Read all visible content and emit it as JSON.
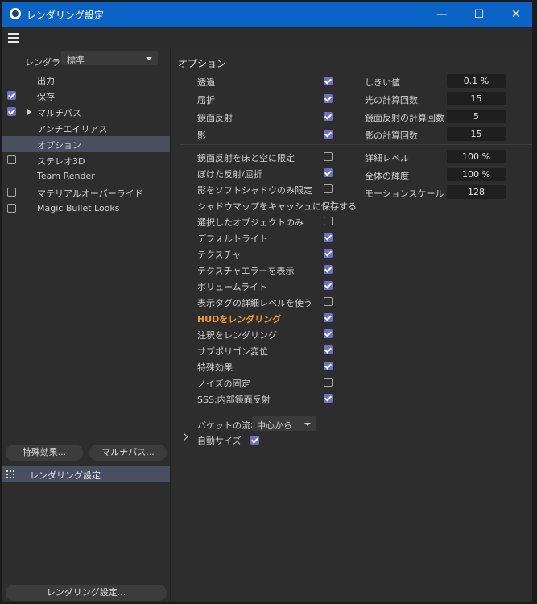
{
  "window": {
    "title": "レンダリング設定",
    "controls": {
      "minimize": "—",
      "maximize": "☐",
      "close": "✕"
    }
  },
  "left": {
    "renderer_label": "レンダラー",
    "renderer_value": "標準",
    "items": [
      {
        "label": "出力",
        "checkbox": null,
        "active": false,
        "expandable": false
      },
      {
        "label": "保存",
        "checkbox": true,
        "active": false,
        "expandable": false
      },
      {
        "label": "マルチパス",
        "checkbox": true,
        "active": false,
        "expandable": true
      },
      {
        "label": "アンチエイリアス",
        "checkbox": null,
        "active": false,
        "expandable": false
      },
      {
        "label": "オプション",
        "checkbox": null,
        "active": true,
        "expandable": false
      },
      {
        "label": "ステレオ3D",
        "checkbox": false,
        "active": false,
        "expandable": false
      },
      {
        "label": "Team Render",
        "checkbox": null,
        "active": false,
        "expandable": false
      },
      {
        "label": "マテリアルオーバーライド",
        "checkbox": false,
        "active": false,
        "expandable": false
      },
      {
        "label": "Magic Bullet Looks",
        "checkbox": false,
        "active": false,
        "expandable": false
      }
    ],
    "effects_button": "特殊効果...",
    "multipass_button": "マルチパス...",
    "preset_item": "レンダリング設定",
    "bottom_button": "レンダリング設定..."
  },
  "options": {
    "title": "オプション",
    "top_checks": [
      {
        "label": "透過",
        "checked": true
      },
      {
        "label": "屈折",
        "checked": true
      },
      {
        "label": "鏡面反射",
        "checked": true
      },
      {
        "label": "影",
        "checked": true
      }
    ],
    "top_fields": [
      {
        "label": "しきい値",
        "value": "0.1 %"
      },
      {
        "label": "光の計算回数",
        "value": "15"
      },
      {
        "label": "鏡面反射の計算回数",
        "value": "5"
      },
      {
        "label": "影の計算回数",
        "value": "15"
      }
    ],
    "mid_fields": [
      {
        "label": "詳細レベル",
        "value": "100 %"
      },
      {
        "label": "全体の輝度",
        "value": "100 %"
      },
      {
        "label": "モーションスケール",
        "value": "128"
      }
    ],
    "checks": [
      {
        "label": "鏡面反射を床と空に限定",
        "checked": false
      },
      {
        "label": "ぼけた反射/屈折",
        "checked": true
      },
      {
        "label": "影をソフトシャドウのみ限定",
        "checked": false
      },
      {
        "label": "シャドウマップをキャッシュに保存する",
        "checked": false
      },
      {
        "label": "選択したオブジェクトのみ",
        "checked": false
      },
      {
        "label": "デフォルトライト",
        "checked": true
      },
      {
        "label": "テクスチャ",
        "checked": true
      },
      {
        "label": "テクスチャエラーを表示",
        "checked": true
      },
      {
        "label": "ボリュームライト",
        "checked": true
      },
      {
        "label": "表示タグの詳細レベルを使う",
        "checked": false
      },
      {
        "label": "HUDをレンダリング",
        "checked": true
      },
      {
        "label": "注釈をレンダリング",
        "checked": true
      },
      {
        "label": "サブポリゴン変位",
        "checked": true
      },
      {
        "label": "特殊効果",
        "checked": true
      },
      {
        "label": "ノイズの固定",
        "checked": false
      },
      {
        "label": "SSS:内部鏡面反射",
        "checked": true
      }
    ],
    "bucket_label": "バケットの流れ",
    "bucket_value": "中心から",
    "autosize_label": "自動サイズ",
    "autosize_checked": true
  },
  "colors": {
    "accent": "#6d6ec4",
    "titlebar": "#0b63c5",
    "hud": "#f29a36"
  }
}
